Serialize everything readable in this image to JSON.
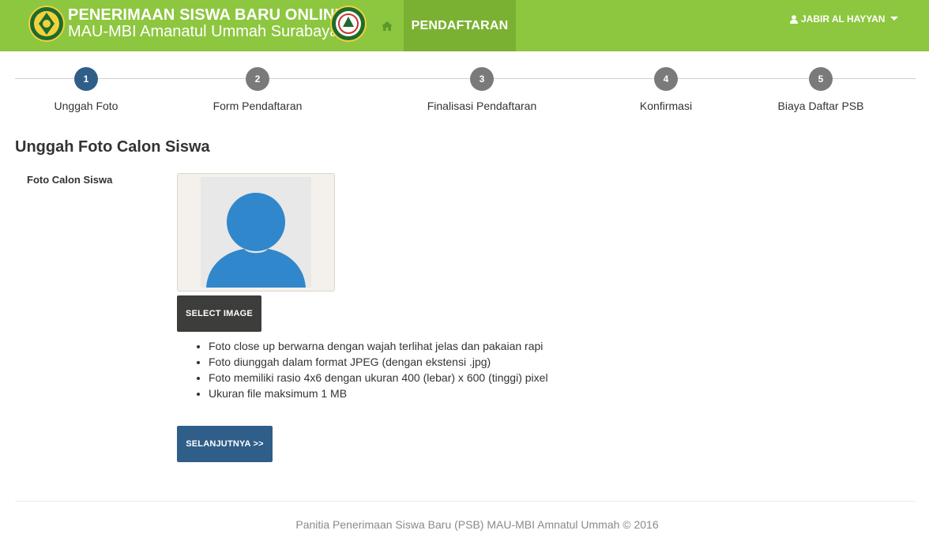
{
  "header": {
    "title": "PENERIMAAN SISWA BARU ONLINE",
    "subtitle": "MAU-MBI Amanatul Ummah Surabaya",
    "home_icon": "home-icon",
    "nav_active": "PENDAFTARAN",
    "user_icon": "user-icon",
    "user_name": "JABIR AL HAYYAN",
    "bg_color": "#8dc63f",
    "active_color": "#7ab133"
  },
  "stepper": {
    "steps": [
      {
        "number": "1",
        "label": "Unggah Foto",
        "state": "done"
      },
      {
        "number": "2",
        "label": "Form Pendaftaran",
        "state": "todo"
      },
      {
        "number": "3",
        "label": "Finalisasi Pendaftaran",
        "state": "todo"
      },
      {
        "number": "4",
        "label": "Konfirmasi",
        "state": "todo"
      },
      {
        "number": "5",
        "label": "Biaya Daftar PSB",
        "state": "todo"
      }
    ],
    "active_color": "#2f5e88",
    "inactive_color": "#7a7a7a"
  },
  "main": {
    "section_title": "Unggah Foto Calon Siswa",
    "field_label": "Foto Calon Siswa",
    "photo_placeholder_icon": "avatar-placeholder-icon",
    "select_button": "SELECT IMAGE",
    "requirements": [
      "Foto close up berwarna dengan wajah terlihat jelas dan pakaian rapi",
      "Foto diunggah dalam format JPEG (dengan ekstensi .jpg)",
      "Foto memiliki rasio 4x6 dengan ukuran 400 (lebar) x 600 (tinggi) pixel",
      "Ukuran file maksimum 1 MB"
    ],
    "next_button": "SELANJUTNYA >>"
  },
  "footer": {
    "text": "Panitia Penerimaan Siswa Baru (PSB) MAU-MBI Amnatul Ummah © 2016"
  }
}
